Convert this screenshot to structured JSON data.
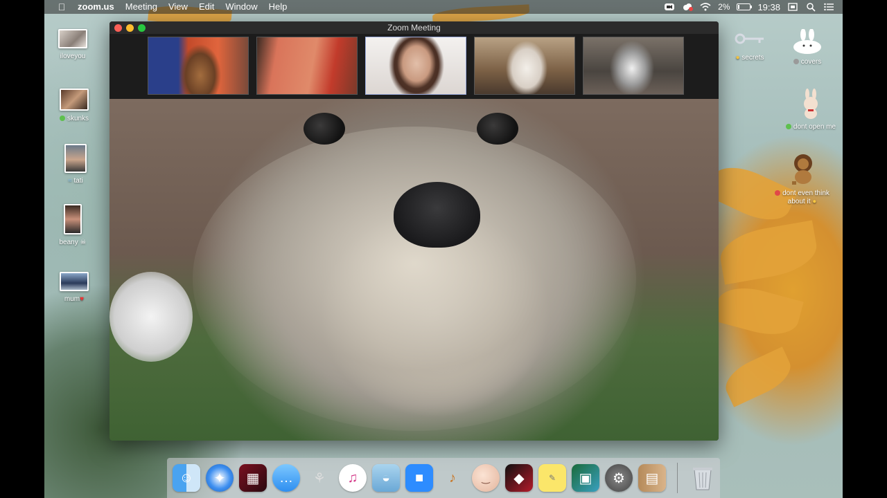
{
  "menubar": {
    "apple_icon": "apple-logo",
    "app": "zoom.us",
    "items": [
      "Meeting",
      "View",
      "Edit",
      "Window",
      "Help"
    ],
    "battery": "2%",
    "time": "19:38"
  },
  "desktop_icons_left": [
    {
      "label": "iloveyou",
      "tag": ""
    },
    {
      "label": "skunks",
      "tag": "green"
    },
    {
      "label": "tati",
      "tag": "wave"
    },
    {
      "label": "beany",
      "tag": "skull"
    },
    {
      "label": "mum",
      "tag": "heart"
    }
  ],
  "desktop_icons_right": [
    {
      "label": "secrets",
      "tag": "face"
    },
    {
      "label": "covers",
      "tag": "gray"
    },
    {
      "label": "dont open me",
      "tag": "green"
    },
    {
      "label": "dont even think about it",
      "tag": "thinking"
    }
  ],
  "zoom": {
    "window_title": "Zoom Meeting",
    "participants": [
      {
        "name": "participant-dachshund",
        "colors": [
          "#c34a2a",
          "#2a3f8a",
          "#a37040"
        ]
      },
      {
        "name": "participant-blurred",
        "colors": [
          "#d9745a",
          "#c23b2b",
          "#7a3a2a"
        ]
      },
      {
        "name": "participant-woman",
        "colors": [
          "#efe9e6",
          "#d7b4a0",
          "#6b4a3a"
        ]
      },
      {
        "name": "participant-terrier",
        "colors": [
          "#8a6b4a",
          "#e8e2da",
          "#5a4a3a"
        ]
      },
      {
        "name": "participant-husky",
        "colors": [
          "#6b6b6b",
          "#e5e5e5",
          "#2b2b2b"
        ]
      }
    ]
  },
  "dock": {
    "apps": [
      "Finder",
      "Safari",
      "Photo Booth",
      "Messages",
      "Cyberduck",
      "iTunes",
      "Sequel Pro",
      "Zoom",
      "GarageBand",
      "Avatar",
      "Photo Editor",
      "Stickies",
      "Preview",
      "System Preferences",
      "Contacts"
    ],
    "trash": "Trash"
  }
}
